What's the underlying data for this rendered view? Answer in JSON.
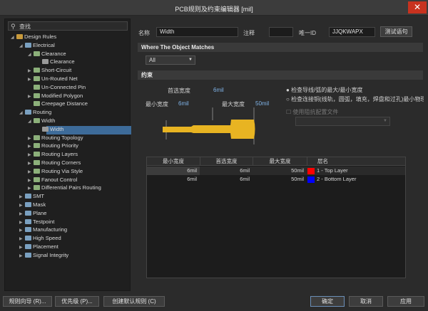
{
  "window": {
    "title": "PCB规则及约束编辑器 [mil]",
    "close": "✕"
  },
  "search": {
    "placeholder": "查找"
  },
  "tree": [
    {
      "label": "Design Rules",
      "arrow": "◢",
      "icon": "rules-folder-icon",
      "level": 0
    },
    {
      "label": "Electrical",
      "arrow": "◢",
      "icon": "electrical-icon",
      "level": 1
    },
    {
      "label": "Clearance",
      "arrow": "◢",
      "icon": "clearance-icon",
      "level": 2
    },
    {
      "label": "Clearance",
      "arrow": "",
      "icon": "clearance-rule-icon",
      "level": 3
    },
    {
      "label": "Short-Circuit",
      "arrow": "▶",
      "icon": "short-circuit-icon",
      "level": 2
    },
    {
      "label": "Un-Routed Net",
      "arrow": "▶",
      "icon": "unrouted-net-icon",
      "level": 2
    },
    {
      "label": "Un-Connected Pin",
      "arrow": "",
      "icon": "unconnected-pin-icon",
      "level": 2
    },
    {
      "label": "Modified Polygon",
      "arrow": "▶",
      "icon": "polygon-icon",
      "level": 2
    },
    {
      "label": "Creepage Distance",
      "arrow": "",
      "icon": "creepage-icon",
      "level": 2
    },
    {
      "label": "Routing",
      "arrow": "◢",
      "icon": "routing-icon",
      "level": 1
    },
    {
      "label": "Width",
      "arrow": "◢",
      "icon": "width-icon",
      "level": 2
    },
    {
      "label": "Width",
      "arrow": "",
      "icon": "width-rule-icon",
      "level": 3
    },
    {
      "label": "Routing Topology",
      "arrow": "▶",
      "icon": "topology-icon",
      "level": 2
    },
    {
      "label": "Routing Priority",
      "arrow": "▶",
      "icon": "priority-icon",
      "level": 2
    },
    {
      "label": "Routing Layers",
      "arrow": "▶",
      "icon": "layers-icon",
      "level": 2
    },
    {
      "label": "Routing Corners",
      "arrow": "▶",
      "icon": "corners-icon",
      "level": 2
    },
    {
      "label": "Routing Via Style",
      "arrow": "▶",
      "icon": "via-style-icon",
      "level": 2
    },
    {
      "label": "Fanout Control",
      "arrow": "▶",
      "icon": "fanout-icon",
      "level": 2
    },
    {
      "label": "Differential Pairs Routing",
      "arrow": "▶",
      "icon": "diff-pairs-icon",
      "level": 2
    },
    {
      "label": "SMT",
      "arrow": "▶",
      "icon": "smt-icon",
      "level": 1
    },
    {
      "label": "Mask",
      "arrow": "▶",
      "icon": "mask-icon",
      "level": 1
    },
    {
      "label": "Plane",
      "arrow": "▶",
      "icon": "plane-icon",
      "level": 1
    },
    {
      "label": "Testpoint",
      "arrow": "▶",
      "icon": "testpoint-icon",
      "level": 1
    },
    {
      "label": "Manufacturing",
      "arrow": "▶",
      "icon": "manufacturing-icon",
      "level": 1
    },
    {
      "label": "High Speed",
      "arrow": "▶",
      "icon": "high-speed-icon",
      "level": 1
    },
    {
      "label": "Placement",
      "arrow": "▶",
      "icon": "placement-icon",
      "level": 1
    },
    {
      "label": "Signal Integrity",
      "arrow": "▶",
      "icon": "signal-integrity-icon",
      "level": 1
    }
  ],
  "rule": {
    "name_label": "名称",
    "name_value": "Width",
    "comment_label": "注释",
    "comment_value": "",
    "uid_label": "唯一ID",
    "uid_value": "JJQKWAPX",
    "test_button": "测试语句"
  },
  "where": {
    "title": "Where The Object Matches",
    "selected": "All"
  },
  "constraints": {
    "title": "约束",
    "preferred_label": "首选宽度",
    "preferred_value": "6mil",
    "min_label": "最小宽度",
    "min_value": "6mil",
    "max_label": "最大宽度",
    "max_value": "50mil",
    "option1": "检查导线/弧的最大/最小宽度",
    "option2": "检查连接铜(线轨，圆弧，填充，焊盘和过孔)最小物理宽度",
    "impedance_label": "使用阻抗配置文件",
    "selected_option": 0,
    "trace_color": "#e8b422"
  },
  "table": {
    "headers": [
      "最小宽度",
      "首选宽度",
      "最大宽度",
      "层名"
    ],
    "rows": [
      {
        "min": "6mil",
        "pref": "6mil",
        "max": "50mil",
        "layer": "1 - Top Layer",
        "color": "#ff0000"
      },
      {
        "min": "6mil",
        "pref": "6mil",
        "max": "50mil",
        "layer": "2 - Bottom Layer",
        "color": "#0000ff"
      }
    ]
  },
  "footer": {
    "wizard": "规则向导 (R)...",
    "priority": "优先级 (P)...",
    "create_default": "创建默认规则 (C)",
    "ok": "确定",
    "cancel": "取消",
    "apply": "应用"
  }
}
